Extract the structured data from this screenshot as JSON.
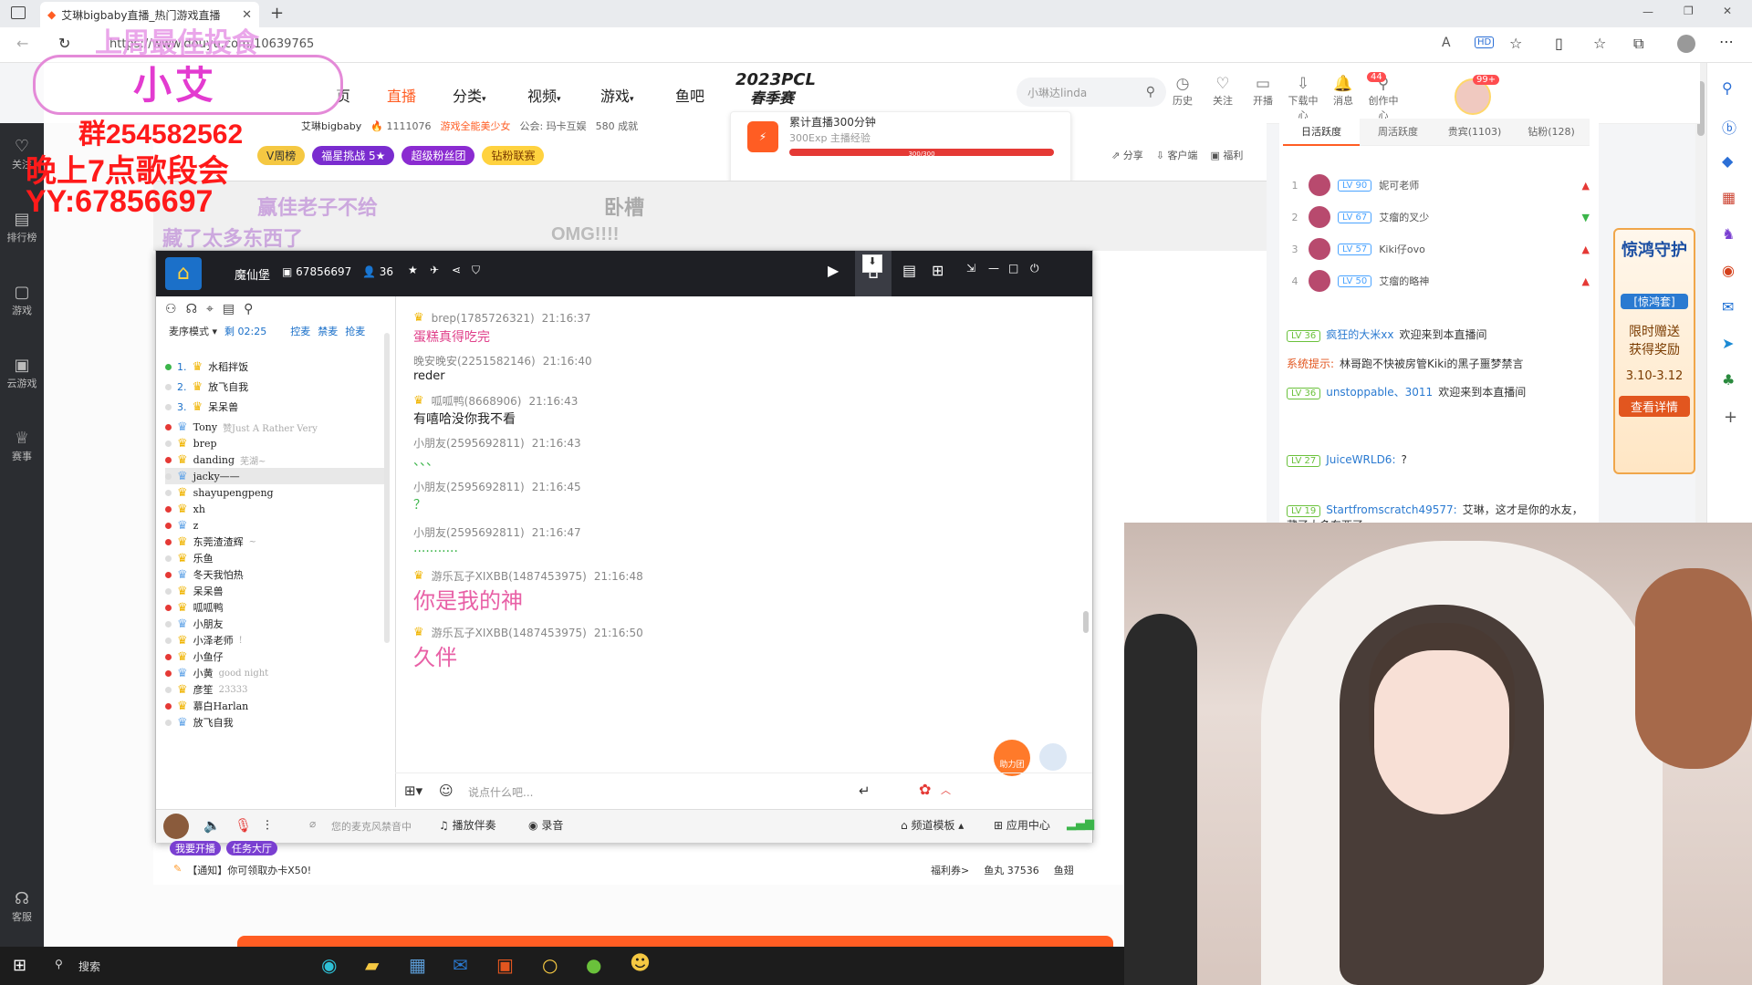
{
  "browser": {
    "tab_title": "艾琳bigbaby直播_热门游戏直播",
    "url": "https://www.douyu.com/10639765",
    "read_aloud_icon": "A",
    "hd_icon": "HD"
  },
  "overlay": {
    "top_text": "上周最佳投食",
    "name_text": "小艾",
    "group_text": "群254582562",
    "singing_text": "晚上7点歌段会",
    "yy_text": "YY:67856697",
    "small1": "赢佳老子不给",
    "small2": "藏了太多东西了",
    "omg": "OMG!!!!",
    "woocao": "卧槽"
  },
  "site_nav": {
    "home": "页",
    "live": "直播",
    "category": "分类",
    "video": "视频",
    "game": "游戏",
    "fishbar": "鱼吧",
    "event_line1": "2023PCL",
    "event_line2": "春季赛",
    "search_placeholder": "小琳达linda",
    "icons": [
      {
        "label": "历史",
        "glyph": "◷"
      },
      {
        "label": "关注",
        "glyph": "♡"
      },
      {
        "label": "开播",
        "glyph": "▭"
      },
      {
        "label": "下载中心",
        "glyph": "⇩"
      },
      {
        "label": "消息",
        "glyph": "🔔"
      },
      {
        "label": "创作中心",
        "glyph": "⚲"
      }
    ],
    "message_badge": "44",
    "avatar_badge": "99+"
  },
  "left_sidebar": [
    {
      "label": "关注",
      "glyph": "♡"
    },
    {
      "label": "排行榜",
      "glyph": "▤"
    },
    {
      "label": "游戏",
      "glyph": "▢"
    },
    {
      "label": "云游戏",
      "glyph": "▣"
    },
    {
      "label": "赛事",
      "glyph": "♕"
    },
    {
      "label": "客服",
      "glyph": "☊"
    }
  ],
  "streamer": {
    "name": "艾琳bigbaby",
    "heat": "1111076",
    "category": "游戏全能美少女",
    "guild": "公会: 玛卡互娱",
    "followers": "580 成就",
    "tags": [
      "V周榜",
      "福星挑战 5★",
      "超级粉丝团",
      "钻粉联赛"
    ],
    "task_title": "累计直播300分钟",
    "task_reward": "300Exp 主播经验",
    "task_progress_text": "300/300",
    "share": "分享",
    "client": "客户端",
    "welfare": "福利"
  },
  "voice_window": {
    "room_name": "魔仙堡",
    "room_id": "67856697",
    "member_count": "36",
    "mode": "麦序模式",
    "remaining": "剩 02:25",
    "actions": [
      "控麦",
      "禁麦",
      "抢麦"
    ],
    "queue": [
      {
        "num": "1.",
        "name": "水稻拌饭"
      },
      {
        "num": "2.",
        "name": "放飞自我"
      },
      {
        "num": "3.",
        "name": "呆呆兽"
      }
    ],
    "members": [
      {
        "name": "Tony",
        "note": "赞Just A Rather Very",
        "red": true
      },
      {
        "name": "brep",
        "note": "",
        "red": false
      },
      {
        "name": "danding",
        "note": "芜湖~",
        "red": true
      },
      {
        "name": "jacky——",
        "note": "",
        "red": false
      },
      {
        "name": "shayupengpeng",
        "note": "",
        "red": false
      },
      {
        "name": "xh",
        "note": "",
        "red": true
      },
      {
        "name": "z",
        "note": "",
        "red": true
      },
      {
        "name": "东莞渣渣辉",
        "note": "~",
        "red": true
      },
      {
        "name": "乐鱼",
        "note": "",
        "red": false
      },
      {
        "name": "冬天我怕热",
        "note": "",
        "red": true
      },
      {
        "name": "呆呆兽",
        "note": "",
        "red": false
      },
      {
        "name": "呱呱鸭",
        "note": "",
        "red": true
      },
      {
        "name": "小朋友",
        "note": "",
        "red": false
      },
      {
        "name": "小泽老师",
        "note": "!",
        "red": false
      },
      {
        "name": "小鱼仔",
        "note": "",
        "red": true
      },
      {
        "name": "小黄",
        "note": "good night",
        "red": true
      },
      {
        "name": "彦笙",
        "note": "23333",
        "red": false
      },
      {
        "name": "慕白Harlan",
        "note": "",
        "red": true
      },
      {
        "name": "放飞自我",
        "note": "",
        "red": false
      }
    ],
    "messages": [
      {
        "user": "brep(1785726321)",
        "time": "21:16:37",
        "text": "蛋糕真得吃完",
        "color": "#e0408a",
        "size": "14px"
      },
      {
        "user": "晚安晚安(2251582146)",
        "time": "21:16:40",
        "text": "reder",
        "color": "#222",
        "size": "13px"
      },
      {
        "user": "呱呱鸭(8668906)",
        "time": "21:16:43",
        "text": "有嘻哈没你我不看",
        "color": "#222",
        "size": "14px"
      },
      {
        "user": "小朋友(2595692811)",
        "time": "21:16:43",
        "text": "、、、",
        "color": "#3bb54a",
        "size": "14px"
      },
      {
        "user": "小朋友(2595692811)",
        "time": "21:16:45",
        "text": "？",
        "color": "#3bb54a",
        "size": "14px"
      },
      {
        "user": "小朋友(2595692811)",
        "time": "21:16:47",
        "text": "...........",
        "color": "#3bb54a",
        "size": "14px"
      },
      {
        "user": "游乐瓦子XIXBB(1487453975)",
        "time": "21:16:48",
        "text": "你是我的神",
        "color": "#e860a6",
        "size": "24px"
      },
      {
        "user": "游乐瓦子XIXBB(1487453975)",
        "time": "21:16:50",
        "text": "久伴",
        "color": "#e860a6",
        "size": "24px"
      }
    ],
    "input_placeholder": "说点什么吧...",
    "mic_status": "您的麦克风禁音中",
    "play_music": "播放伴奏",
    "record": "录音",
    "channel_template": "频道模板",
    "app_center": "应用中心",
    "boost_label": "助力团"
  },
  "below_window": {
    "notice": "【通知】你可领取办卡X50!",
    "welfare_coupon": "福利券>",
    "fishball": "鱼丸 37536",
    "fishwing": "鱼翅",
    "tags": [
      "我要开播",
      "任务大厅"
    ]
  },
  "right_panel": {
    "tabs": [
      "日活跃度",
      "周活跃度",
      "贵宾(1103)",
      "钻粉(128)"
    ],
    "ranks": [
      {
        "num": "1",
        "lv": "LV 90",
        "name": "妮可老师",
        "arrow": "up"
      },
      {
        "num": "2",
        "lv": "LV 67",
        "name": "艾瘤的叉少",
        "arrow": "down"
      },
      {
        "num": "3",
        "lv": "LV 57",
        "name": "Kiki仔ovo",
        "arrow": "up"
      },
      {
        "num": "4",
        "lv": "LV 50",
        "name": "艾瘤的略神",
        "arrow": "up"
      }
    ],
    "chat": [
      {
        "lv": "LV 36",
        "user": "疯狂的大米xx",
        "text": "欢迎来到本直播间"
      },
      {
        "lv": "",
        "user": "系统提示:",
        "text": "林哥跑不快被房管Kiki的黑子噩梦禁言"
      },
      {
        "lv": "LV 36",
        "user": "unstoppable、3011",
        "text": "欢迎来到本直播间"
      },
      {
        "lv": "LV 27",
        "user": "JuiceWRLD6:",
        "text": "?"
      },
      {
        "lv": "LV 19",
        "user": "Startfromscratch49577:",
        "text": "艾琳，这才是你的水友，藏了太多东西了"
      }
    ],
    "promo_title": "惊鸿守护",
    "promo_sub": "[惊鸿套]",
    "promo_line1": "限时赠送",
    "promo_line2": "获得奖励",
    "promo_date": "3.10-3.12",
    "promo_btn": "查看详情"
  },
  "taskbar": {
    "search": "搜索"
  },
  "colors": {
    "douyu_orange": "#ff5d23",
    "voice_titlebar": "#1e1f24",
    "pink_text": "#e860a6",
    "overlay_red": "#ff1a1a"
  }
}
